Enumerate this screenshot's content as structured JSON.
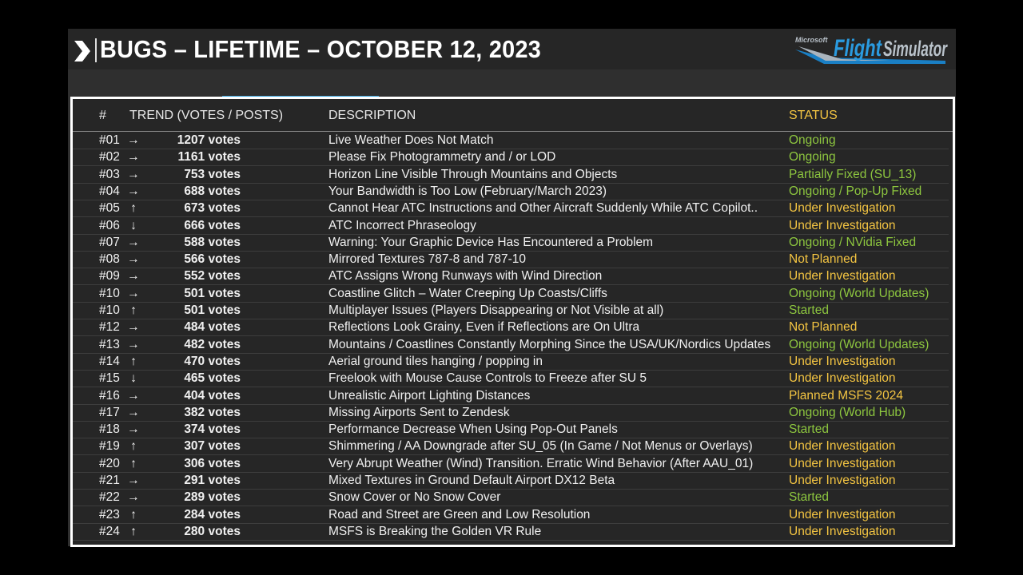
{
  "title": "BUGS – LIFETIME – OCTOBER 12, 2023",
  "logo": {
    "brand": "Microsoft",
    "name": "Flight Simulator"
  },
  "colors": {
    "green": "#8dc63f",
    "yellow": "#f4c542",
    "accent": "#3aa7e0"
  },
  "columns": {
    "num": "#",
    "trend": "TREND  (VOTES / POSTS)",
    "description": "DESCRIPTION",
    "status": "STATUS"
  },
  "rows": [
    {
      "num": "#01",
      "trend": "right",
      "votes": "1207",
      "unit": "votes",
      "description": "Live Weather Does Not Match",
      "status": "Ongoing",
      "status_color": "green"
    },
    {
      "num": "#02",
      "trend": "right",
      "votes": "1161",
      "unit": "votes",
      "description": "Please Fix Photogrammetry and / or LOD",
      "status": "Ongoing",
      "status_color": "green"
    },
    {
      "num": "#03",
      "trend": "right",
      "votes": "753",
      "unit": "votes",
      "description": "Horizon Line Visible Through Mountains and Objects",
      "status": "Partially Fixed (SU_13)",
      "status_color": "green"
    },
    {
      "num": "#04",
      "trend": "right",
      "votes": "688",
      "unit": "votes",
      "description": "Your Bandwidth is Too Low (February/March 2023)",
      "status": "Ongoing / Pop-Up Fixed",
      "status_color": "green"
    },
    {
      "num": "#05",
      "trend": "up",
      "votes": "673",
      "unit": "votes",
      "description": "Cannot Hear ATC Instructions and Other Aircraft Suddenly While ATC Copilot..",
      "status": "Under Investigation",
      "status_color": "yellow"
    },
    {
      "num": "#06",
      "trend": "down",
      "votes": "666",
      "unit": "votes",
      "description": "ATC Incorrect Phraseology",
      "status": "Under Investigation",
      "status_color": "yellow"
    },
    {
      "num": "#07",
      "trend": "right",
      "votes": "588",
      "unit": "votes",
      "description": "Warning: Your Graphic Device Has Encountered a Problem",
      "status": "Ongoing / NVidia Fixed",
      "status_color": "green"
    },
    {
      "num": "#08",
      "trend": "right",
      "votes": "566",
      "unit": "votes",
      "description": "Mirrored Textures 787-8 and 787-10",
      "status": "Not Planned",
      "status_color": "yellow"
    },
    {
      "num": "#09",
      "trend": "right",
      "votes": "552",
      "unit": "votes",
      "description": "ATC Assigns Wrong Runways with Wind Direction",
      "status": "Under Investigation",
      "status_color": "yellow"
    },
    {
      "num": "#10",
      "trend": "right",
      "votes": "501",
      "unit": "votes",
      "description": "Coastline Glitch – Water Creeping Up Coasts/Cliffs",
      "status": "Ongoing (World Updates)",
      "status_color": "green"
    },
    {
      "num": "#10",
      "trend": "up",
      "votes": "501",
      "unit": "votes",
      "description": "Multiplayer Issues (Players Disappearing or Not Visible at all)",
      "status": "Started",
      "status_color": "green"
    },
    {
      "num": "#12",
      "trend": "right",
      "votes": "484",
      "unit": "votes",
      "description": "Reflections Look Grainy, Even if Reflections are On Ultra",
      "status": "Not Planned",
      "status_color": "yellow"
    },
    {
      "num": "#13",
      "trend": "right",
      "votes": "482",
      "unit": "votes",
      "description": "Mountains / Coastlines Constantly Morphing Since the USA/UK/Nordics Updates",
      "status": "Ongoing (World Updates)",
      "status_color": "green"
    },
    {
      "num": "#14",
      "trend": "up",
      "votes": "470",
      "unit": "votes",
      "description": "Aerial ground tiles hanging / popping in",
      "status": "Under Investigation",
      "status_color": "yellow"
    },
    {
      "num": "#15",
      "trend": "down",
      "votes": "465",
      "unit": "votes",
      "description": "Freelook with Mouse Cause Controls to Freeze after SU 5",
      "status": "Under Investigation",
      "status_color": "yellow"
    },
    {
      "num": "#16",
      "trend": "right",
      "votes": "404",
      "unit": "votes",
      "description": "Unrealistic Airport Lighting Distances",
      "status": "Planned MSFS 2024",
      "status_color": "yellow"
    },
    {
      "num": "#17",
      "trend": "right",
      "votes": "382",
      "unit": "votes",
      "description": "Missing Airports Sent to Zendesk",
      "status": "Ongoing (World Hub)",
      "status_color": "green"
    },
    {
      "num": "#18",
      "trend": "right",
      "votes": "374",
      "unit": "votes",
      "description": "Performance Decrease When Using Pop-Out Panels",
      "status": "Started",
      "status_color": "green"
    },
    {
      "num": "#19",
      "trend": "up",
      "votes": "307",
      "unit": "votes",
      "description": "Shimmering / AA Downgrade after SU_05 (In Game / Not Menus or Overlays)",
      "status": "Under Investigation",
      "status_color": "yellow"
    },
    {
      "num": "#20",
      "trend": "up",
      "votes": "306",
      "unit": "votes",
      "description": "Very Abrupt Weather (Wind) Transition. Erratic Wind Behavior (After AAU_01)",
      "status": "Under Investigation",
      "status_color": "yellow"
    },
    {
      "num": "#21",
      "trend": "right",
      "votes": "291",
      "unit": "votes",
      "description": "Mixed Textures in Ground Default Airport DX12 Beta",
      "status": "Under Investigation",
      "status_color": "yellow"
    },
    {
      "num": "#22",
      "trend": "right",
      "votes": "289",
      "unit": "votes",
      "description": "Snow Cover or No Snow Cover",
      "status": "Started",
      "status_color": "green"
    },
    {
      "num": "#23",
      "trend": "up",
      "votes": "284",
      "unit": "votes",
      "description": "Road and Street are Green and Low Resolution",
      "status": "Under Investigation",
      "status_color": "yellow"
    },
    {
      "num": "#24",
      "trend": "up",
      "votes": "280",
      "unit": "votes",
      "description": "MSFS is Breaking the Golden VR Rule",
      "status": "Under Investigation",
      "status_color": "yellow"
    }
  ]
}
